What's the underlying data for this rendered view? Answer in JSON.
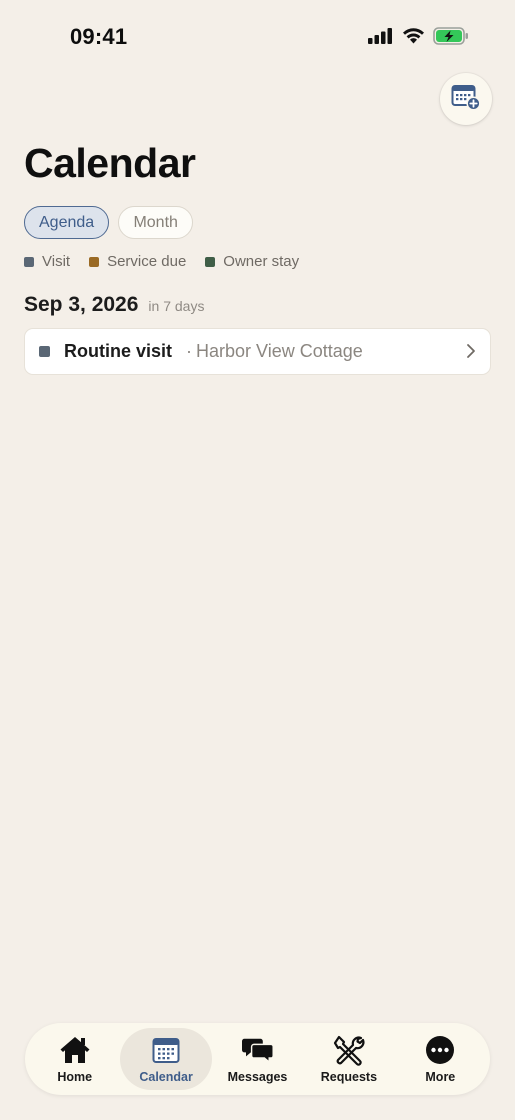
{
  "status_bar": {
    "time": "09:41"
  },
  "header": {
    "title": "Calendar",
    "add_button_icon": "calendar-add-icon"
  },
  "view_tabs": [
    {
      "label": "Agenda",
      "active": true
    },
    {
      "label": "Month",
      "active": false
    }
  ],
  "legend": [
    {
      "label": "Visit",
      "color": "#5a6775"
    },
    {
      "label": "Service due",
      "color": "#9a6a24"
    },
    {
      "label": "Owner stay",
      "color": "#3f5e47"
    }
  ],
  "agenda": {
    "groups": [
      {
        "date": "Sep 3, 2026",
        "relative": "in 7 days",
        "events": [
          {
            "title": "Routine visit",
            "separator": "·",
            "location": "Harbor View Cottage",
            "color": "#5a6775"
          }
        ]
      }
    ]
  },
  "tab_bar": {
    "items": [
      {
        "label": "Home",
        "icon": "home-icon"
      },
      {
        "label": "Calendar",
        "icon": "calendar-icon",
        "selected": true
      },
      {
        "label": "Messages",
        "icon": "messages-icon"
      },
      {
        "label": "Requests",
        "icon": "tools-icon"
      },
      {
        "label": "More",
        "icon": "more-icon"
      }
    ]
  },
  "colors": {
    "background": "#f4efe8",
    "accent": "#3f5d8a",
    "battery": "#34c759"
  }
}
